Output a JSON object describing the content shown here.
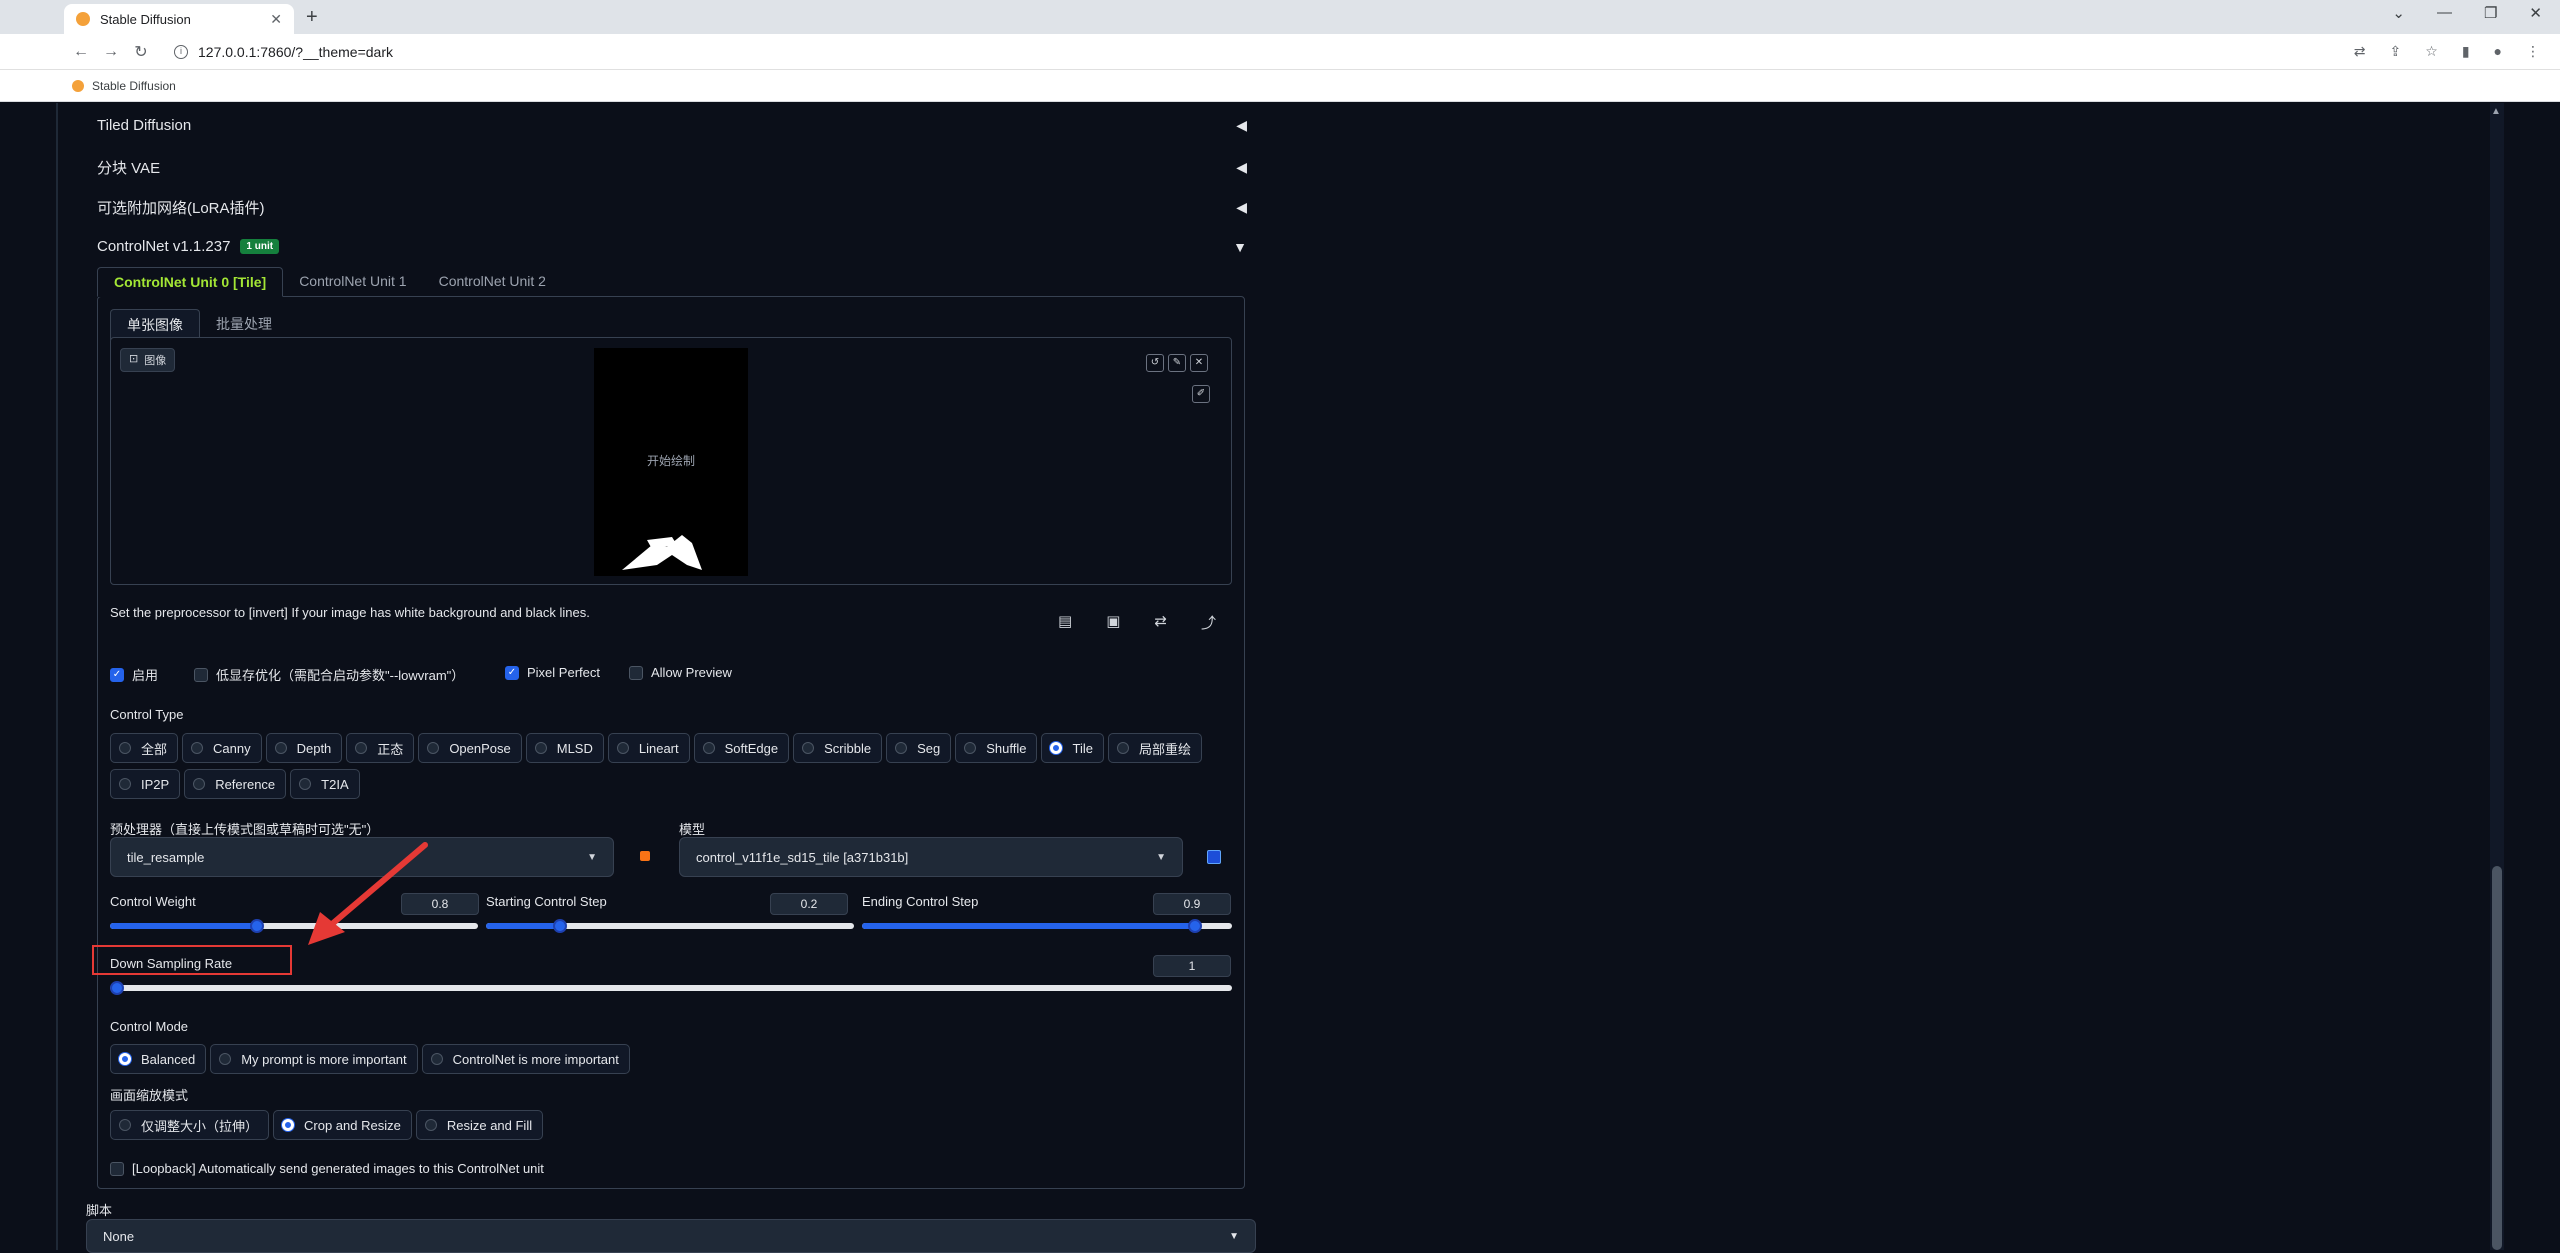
{
  "browser": {
    "tab_title": "Stable Diffusion",
    "tab_close": "✕",
    "new_tab": "+",
    "url": "127.0.0.1:7860/?__theme=dark",
    "bookmark": "Stable Diffusion",
    "window_buttons": [
      "⌄",
      "—",
      "❐",
      "✕"
    ]
  },
  "accordions": {
    "tiled_diffusion": "Tiled Diffusion",
    "tiled_vae": "分块 VAE",
    "lora": "可选附加网络(LoRA插件)",
    "controlnet": "ControlNet v1.1.237",
    "controlnet_badge": "1 unit"
  },
  "controlnet_tabs": [
    "ControlNet Unit 0 [Tile]",
    "ControlNet Unit 1",
    "ControlNet Unit 2"
  ],
  "image_tabs": [
    "单张图像",
    "批量处理"
  ],
  "image_box": {
    "label": "图像",
    "canvas_text": "开始绘制"
  },
  "hint": "Set the preprocessor to [invert] If your image has white background and black lines.",
  "checkboxes": {
    "enable": "启用",
    "enable_checked": true,
    "lowvram": "低显存优化（需配合启动参数\"--lowvram\"）",
    "lowvram_checked": false,
    "pixel_perfect": "Pixel Perfect",
    "pixel_perfect_checked": true,
    "allow_preview": "Allow Preview",
    "allow_preview_checked": false
  },
  "control_type": {
    "label": "Control Type",
    "row1": [
      "全部",
      "Canny",
      "Depth",
      "正态",
      "OpenPose",
      "MLSD",
      "Lineart",
      "SoftEdge",
      "Scribble",
      "Seg",
      "Shuffle",
      "Tile",
      "局部重绘"
    ],
    "row2": [
      "IP2P",
      "Reference",
      "T2IA"
    ],
    "selected": "Tile"
  },
  "preprocessor": {
    "label": "预处理器（直接上传模式图或草稿时可选\"无\"）",
    "value": "tile_resample"
  },
  "model": {
    "label": "模型",
    "value": "control_v11f1e_sd15_tile [a371b31b]"
  },
  "sliders": {
    "control_weight": {
      "label": "Control Weight",
      "value": "0.8",
      "fraction": 0.4
    },
    "starting_step": {
      "label": "Starting Control Step",
      "value": "0.2",
      "fraction": 0.2
    },
    "ending_step": {
      "label": "Ending Control Step",
      "value": "0.9",
      "fraction": 0.9
    },
    "down_sampling": {
      "label": "Down Sampling Rate",
      "value": "1",
      "fraction": 0.0
    }
  },
  "control_mode": {
    "label": "Control Mode",
    "options": [
      "Balanced",
      "My prompt is more important",
      "ControlNet is more important"
    ],
    "selected": "Balanced"
  },
  "resize_mode": {
    "label": "画面缩放模式",
    "options": [
      "仅调整大小（拉伸）",
      "Crop and Resize",
      "Resize and Fill"
    ],
    "selected": "Crop and Resize"
  },
  "loopback": "[Loopback] Automatically send generated images to this ControlNet unit",
  "script": {
    "label": "脚本",
    "value": "None"
  },
  "colors": {
    "accent": "#2563eb",
    "active_tab": "#a3e635",
    "highlight_red": "#e53935",
    "badge_green": "#15803d"
  }
}
